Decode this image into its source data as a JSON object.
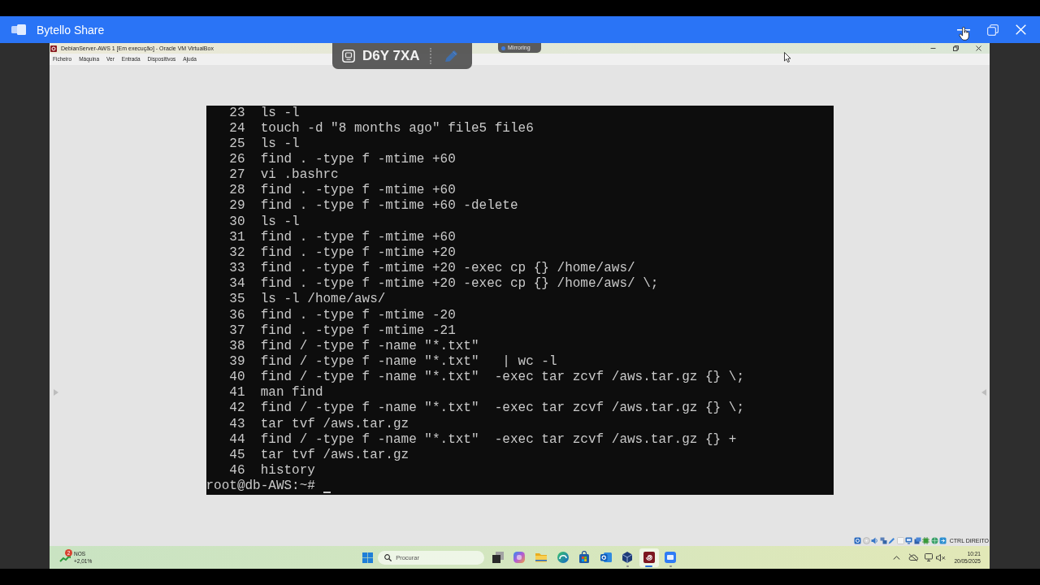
{
  "window": {
    "title": "Bytello Share"
  },
  "share_code": {
    "code": "D6Y 7XA"
  },
  "mirroring_tag": {
    "label": "Mirroring"
  },
  "vm_window": {
    "title": "DebianServer-AWS 1 [Em execução] - Oracle VM VirtualBox",
    "menu": [
      "Ficheiro",
      "Máquina",
      "Ver",
      "Entrada",
      "Dispositivos",
      "Ajuda"
    ]
  },
  "terminal": {
    "history": [
      {
        "number": "23",
        "command": "ls -l"
      },
      {
        "number": "24",
        "command": "touch -d \"8 months ago\" file5 file6"
      },
      {
        "number": "25",
        "command": "ls -l"
      },
      {
        "number": "26",
        "command": "find . -type f -mtime +60"
      },
      {
        "number": "27",
        "command": "vi .bashrc"
      },
      {
        "number": "28",
        "command": "find . -type f -mtime +60"
      },
      {
        "number": "29",
        "command": "find . -type f -mtime +60 -delete"
      },
      {
        "number": "30",
        "command": "ls -l"
      },
      {
        "number": "31",
        "command": "find . -type f -mtime +60"
      },
      {
        "number": "32",
        "command": "find . -type f -mtime +20"
      },
      {
        "number": "33",
        "command": "find . -type f -mtime +20 -exec cp {} /home/aws/"
      },
      {
        "number": "34",
        "command": "find . -type f -mtime +20 -exec cp {} /home/aws/ \\;"
      },
      {
        "number": "35",
        "command": "ls -l /home/aws/"
      },
      {
        "number": "36",
        "command": "find . -type f -mtime -20"
      },
      {
        "number": "37",
        "command": "find . -type f -mtime -21"
      },
      {
        "number": "38",
        "command": "find / -type f -name \"*.txt\""
      },
      {
        "number": "39",
        "command": "find / -type f -name \"*.txt\"   | wc -l"
      },
      {
        "number": "40",
        "command": "find / -type f -name \"*.txt\"  -exec tar zcvf /aws.tar.gz {} \\;"
      },
      {
        "number": "41",
        "command": "man find"
      },
      {
        "number": "42",
        "command": "find / -type f -name \"*.txt\"  -exec tar zcvf /aws.tar.gz {} \\;"
      },
      {
        "number": "43",
        "command": "tar tvf /aws.tar.gz"
      },
      {
        "number": "44",
        "command": "find / -type f -name \"*.txt\"  -exec tar zcvf /aws.tar.gz {} +"
      },
      {
        "number": "45",
        "command": "tar tvf /aws.tar.gz"
      },
      {
        "number": "46",
        "command": "history"
      }
    ],
    "prompt": "root@db-AWS:~#"
  },
  "vm_status_bar": {
    "host_key": "CTRL DIREITO"
  },
  "taskbar": {
    "widget": {
      "badge": "2",
      "title": "NOS",
      "change": "+2,01%"
    },
    "search": {
      "placeholder": "Procurar"
    },
    "apps": [
      {
        "kind": "taskview",
        "selected": false,
        "running": false
      },
      {
        "kind": "assistant",
        "selected": false,
        "running": false
      },
      {
        "kind": "files",
        "selected": false,
        "running": false
      },
      {
        "kind": "browser",
        "selected": false,
        "running": false
      },
      {
        "kind": "store",
        "selected": false,
        "running": false
      },
      {
        "kind": "mail",
        "selected": false,
        "running": false
      },
      {
        "kind": "virtualizer",
        "selected": false,
        "running": true
      },
      {
        "kind": "vm",
        "selected": true,
        "running": true
      },
      {
        "kind": "share",
        "selected": false,
        "running": true
      }
    ],
    "clock": {
      "time": "10:21",
      "date": "20/05/2025"
    }
  }
}
